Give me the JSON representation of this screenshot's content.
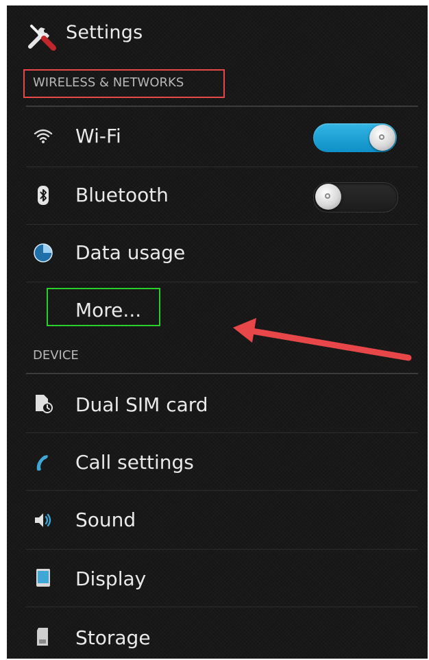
{
  "app": {
    "title": "Settings",
    "icon": "tools-icon"
  },
  "sections": {
    "wireless": {
      "header": "WIRELESS & NETWORKS",
      "items": [
        {
          "label": "Wi-Fi",
          "icon": "wifi-icon",
          "toggle": "on"
        },
        {
          "label": "Bluetooth",
          "icon": "bluetooth-icon",
          "toggle": "off"
        },
        {
          "label": "Data usage",
          "icon": "data-usage-icon"
        },
        {
          "label": "More..."
        }
      ]
    },
    "device": {
      "header": "DEVICE",
      "items": [
        {
          "label": "Dual SIM card",
          "icon": "dual-sim-icon"
        },
        {
          "label": "Call settings",
          "icon": "phone-handset-icon"
        },
        {
          "label": "Sound",
          "icon": "speaker-icon"
        },
        {
          "label": "Display",
          "icon": "display-icon"
        },
        {
          "label": "Storage",
          "icon": "storage-icon"
        }
      ]
    }
  },
  "colors": {
    "background": "#161616",
    "toggle_on": "#33b5e5",
    "annotation_red": "#e8474a",
    "annotation_green": "#2bd12b"
  }
}
